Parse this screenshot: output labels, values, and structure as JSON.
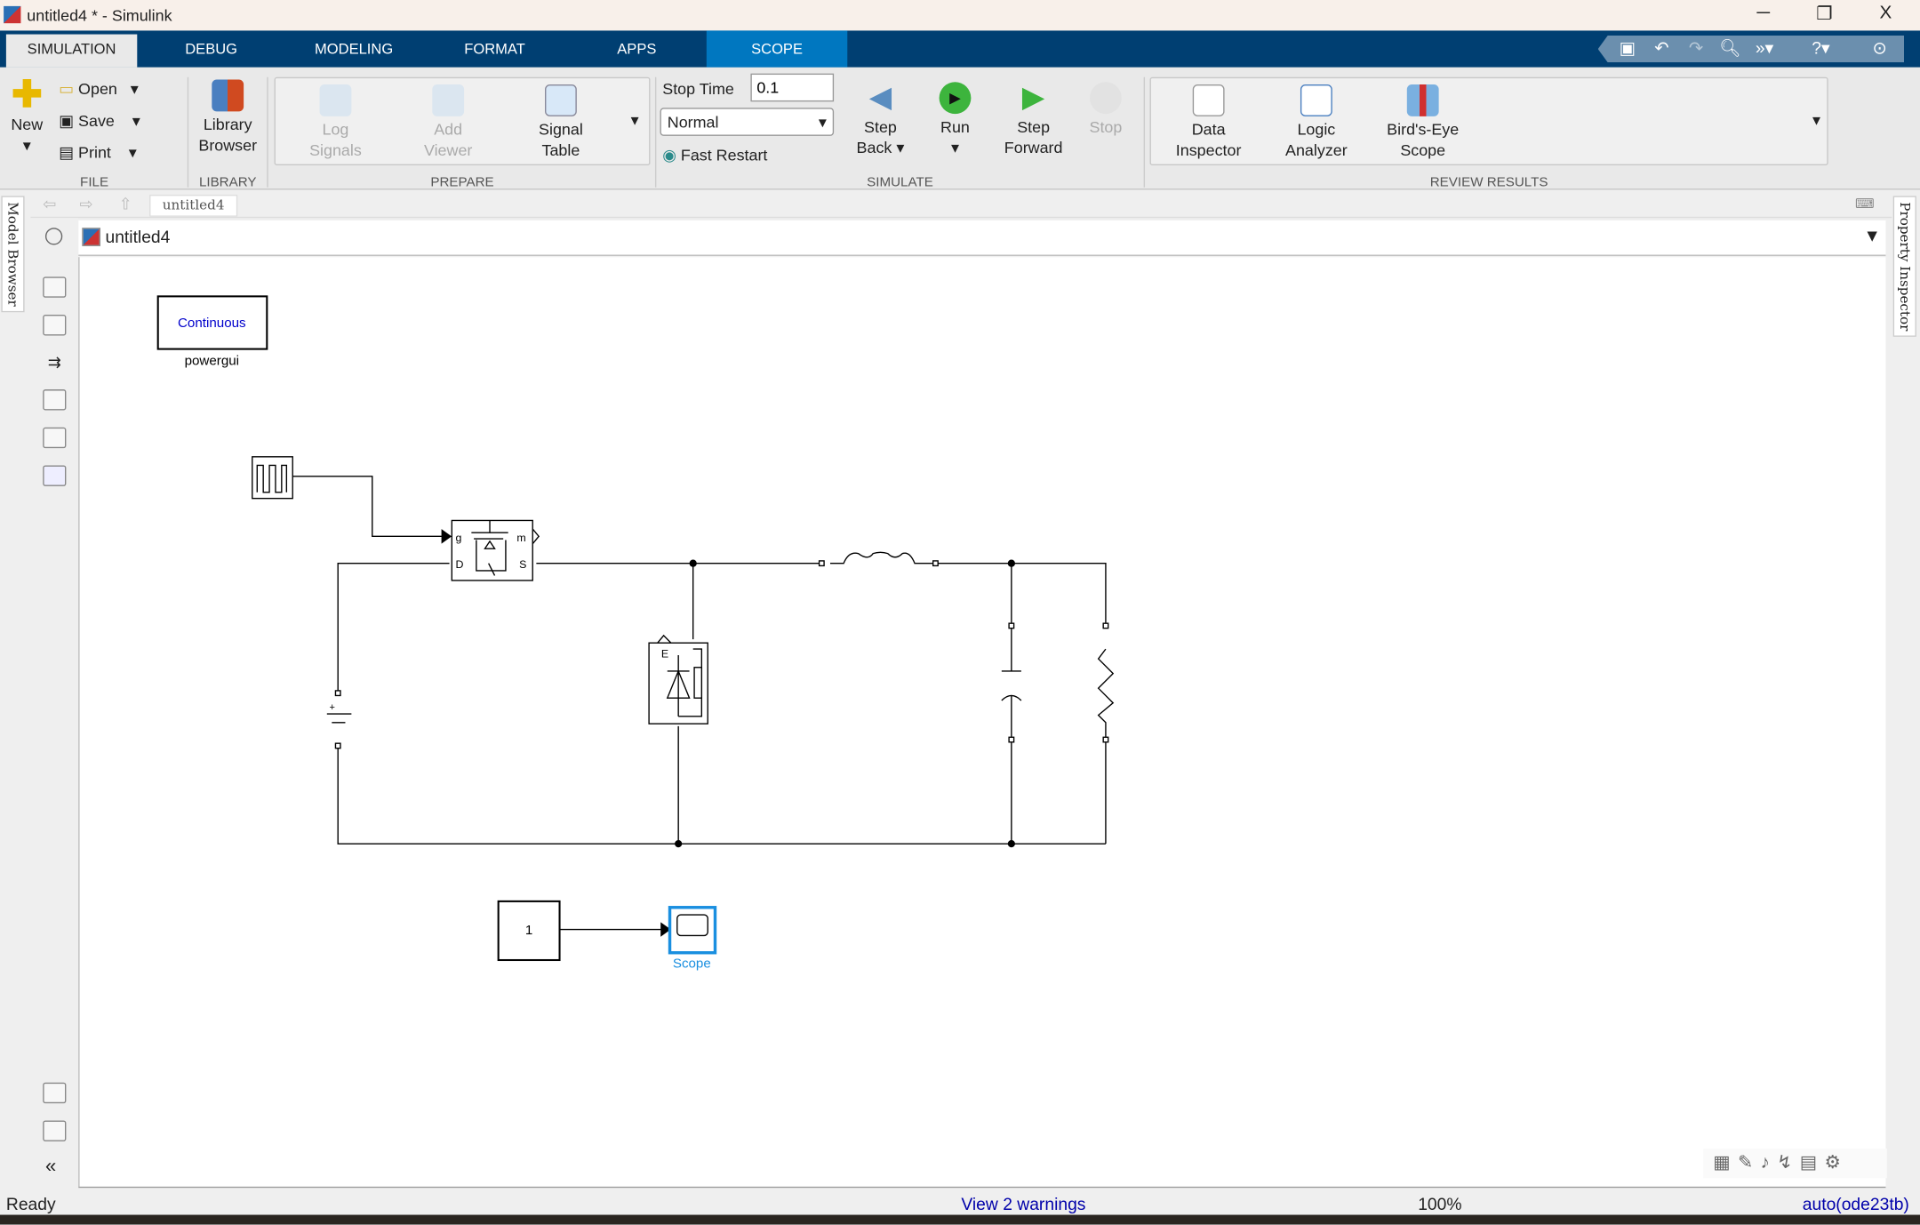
{
  "window": {
    "title": "untitled4 * - Simulink",
    "minimize": "─",
    "restore": "❐",
    "close": "X"
  },
  "tabs": [
    {
      "label": "SIMULATION",
      "active": true
    },
    {
      "label": "DEBUG"
    },
    {
      "label": "MODELING"
    },
    {
      "label": "FORMAT"
    },
    {
      "label": "APPS"
    },
    {
      "label": "SCOPE",
      "contextual": true
    }
  ],
  "ribbon": {
    "file": {
      "section": "FILE",
      "new": "New",
      "open": "Open",
      "save": "Save",
      "print": "Print"
    },
    "library": {
      "section": "LIBRARY",
      "browser_line1": "Library",
      "browser_line2": "Browser"
    },
    "prepare": {
      "section": "PREPARE",
      "log_line1": "Log",
      "log_line2": "Signals",
      "viewer_line1": "Add",
      "viewer_line2": "Viewer",
      "table_line1": "Signal",
      "table_line2": "Table"
    },
    "simulate": {
      "section": "SIMULATE",
      "stop_time_label": "Stop Time",
      "stop_time_value": "0.1",
      "mode": "Normal",
      "fast_restart": "Fast Restart",
      "step_back_line1": "Step",
      "step_back_line2": "Back",
      "run": "Run",
      "step_fwd_line1": "Step",
      "step_fwd_line2": "Forward",
      "stop": "Stop"
    },
    "review": {
      "section": "REVIEW RESULTS",
      "di_line1": "Data",
      "di_line2": "Inspector",
      "la_line1": "Logic",
      "la_line2": "Analyzer",
      "be_line1": "Bird's-Eye",
      "be_line2": "Scope"
    }
  },
  "breadcrumb": "untitled4",
  "model_header": "untitled4",
  "side_tabs": {
    "left": "Model Browser",
    "right": "Property Inspector"
  },
  "blocks": {
    "powergui_mode": "Continuous",
    "powergui_label": "powergui",
    "mosfet_g": "g",
    "mosfet_m": "m",
    "mosfet_d": "D",
    "mosfet_s": "S",
    "constant_value": "1",
    "scope_label": "Scope",
    "diode_e": "E"
  },
  "status": {
    "left": "Ready",
    "warnings": "View 2 warnings",
    "zoom": "100%",
    "solver": "auto(ode23tb)"
  },
  "colors": {
    "tabbar": "#003f72",
    "scope_tab": "#0077c0",
    "link": "#0000cc",
    "scope_blue": "#1a8fe0"
  }
}
